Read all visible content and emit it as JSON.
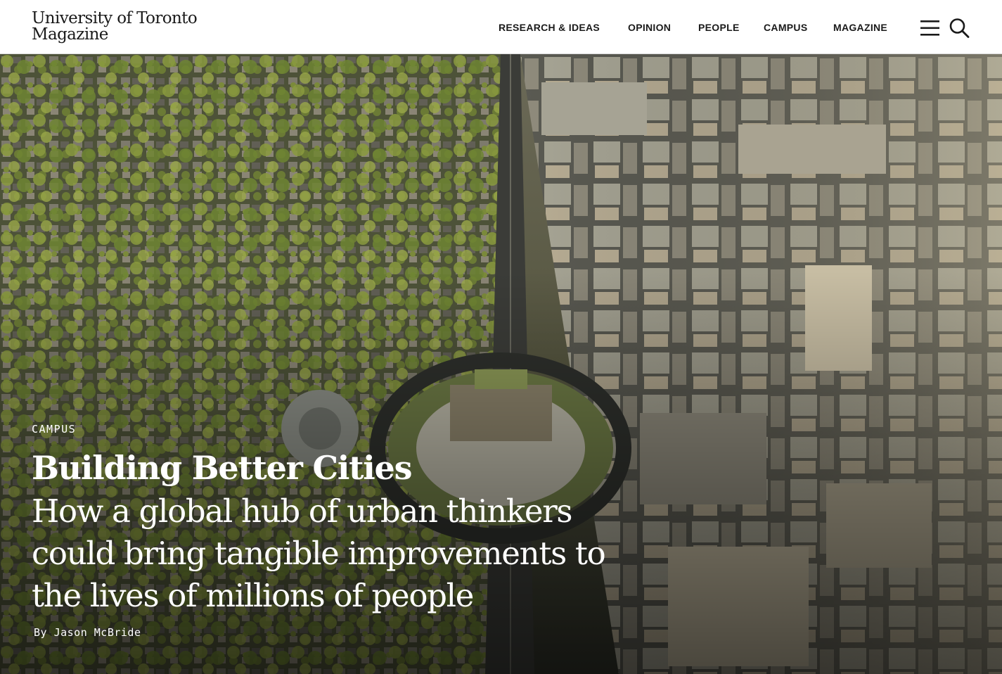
{
  "site": {
    "logo_line1": "University of Toronto",
    "logo_line2": "Magazine"
  },
  "nav": {
    "items": [
      {
        "label": "RESEARCH & IDEAS"
      },
      {
        "label": "OPINION"
      },
      {
        "label": "PEOPLE"
      },
      {
        "label": "CAMPUS"
      },
      {
        "label": "MAGAZINE"
      }
    ],
    "menu_icon": "hamburger-menu-icon",
    "search_icon": "search-icon"
  },
  "hero": {
    "category": "CAMPUS",
    "title": "Building Better Cities",
    "subtitle": "How a global hub of urban thinkers could bring tangible improvements to the lives of millions of people",
    "byline": "By Jason McBride",
    "image_subject": "aerial-city-campus-photo"
  },
  "colors": {
    "text_dark": "#1a1a1a",
    "header_bg": "#ffffff",
    "hero_text": "#ffffff"
  }
}
